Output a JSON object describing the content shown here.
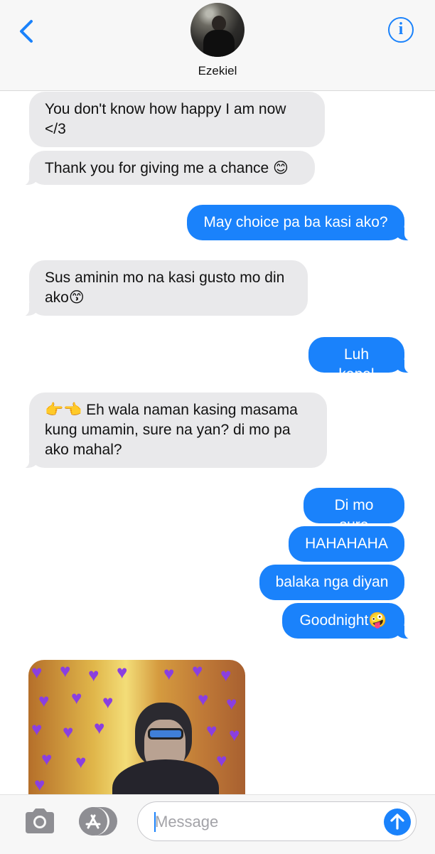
{
  "header": {
    "contact_name": "Ezekiel",
    "back_icon": "chevron-left-icon",
    "info_label": "i"
  },
  "messages": [
    {
      "side": "received",
      "text": "You don't know how happy I am now\n</3"
    },
    {
      "side": "received",
      "text": "Thank you for giving me a chance 😊"
    },
    {
      "side": "sent",
      "text": "May choice pa ba kasi ako?"
    },
    {
      "side": "received",
      "text": "Sus aminin mo na kasi gusto mo din\nako😙"
    },
    {
      "side": "sent",
      "text": "Luh kapal"
    },
    {
      "side": "received",
      "text": "👉👈 Eh wala naman kasing masama\nkung umamin, sure na yan? di mo pa\nako mahal?"
    },
    {
      "side": "sent",
      "text": "Di mo sure"
    },
    {
      "side": "sent",
      "text": "HAHAHAHA"
    },
    {
      "side": "sent",
      "text": "balaka nga diyan"
    },
    {
      "side": "sent",
      "text": "Goodnight🤪"
    }
  ],
  "attachment": {
    "type": "photo",
    "icon": "purple-heart-icon"
  },
  "composer": {
    "placeholder": "Message",
    "value": "",
    "camera_icon": "camera-icon",
    "apps_icon": "app-store-icon",
    "send_icon": "arrow-up-icon"
  },
  "colors": {
    "sent_bubble": "#1a82fb",
    "received_bubble": "#e9e9eb",
    "accent": "#1a82fb"
  }
}
